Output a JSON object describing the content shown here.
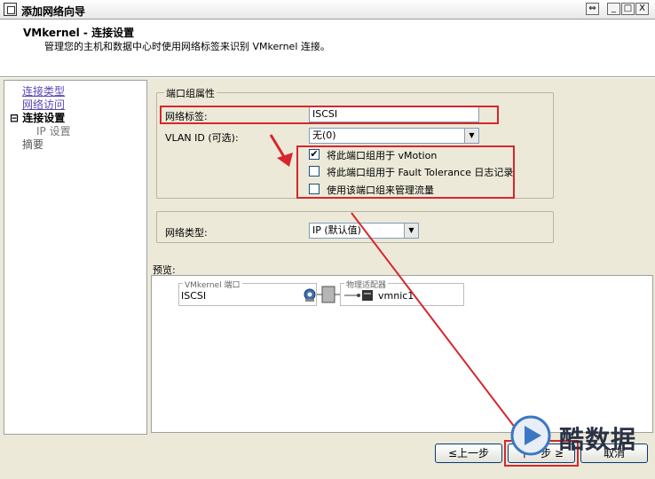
{
  "window": {
    "title": "添加网络向导",
    "controls": {
      "restore": "⇔",
      "minimize": "_",
      "maximize": "□",
      "close": "X"
    }
  },
  "header": {
    "title": "VMkernel - 连接设置",
    "description": "管理您的主机和数据中心时使用网络标签来识别 VMkernel 连接。"
  },
  "nav": {
    "items": [
      {
        "label": "连接类型",
        "state": "link"
      },
      {
        "label": "网络访问",
        "state": "link"
      },
      {
        "label": "连接设置",
        "state": "current",
        "prefix": "⊟"
      },
      {
        "label": "IP 设置",
        "state": "sub"
      },
      {
        "label": "摘要",
        "state": "inactive"
      }
    ]
  },
  "port_group": {
    "legend": "端口组属性",
    "network_label": {
      "label": "网络标签:",
      "value": "ISCSI"
    },
    "vlan": {
      "label": "VLAN ID (可选):",
      "value": "无(0)"
    },
    "options": [
      {
        "label": "将此端口组用于 vMotion",
        "checked": true,
        "mark": "✔"
      },
      {
        "label": "将此端口组用于 Fault Tolerance 日志记录",
        "checked": false,
        "mark": ""
      },
      {
        "label": "使用该端口组来管理流量",
        "checked": false,
        "mark": ""
      }
    ]
  },
  "network_type": {
    "label": "网络类型:",
    "value": "IP (默认值)"
  },
  "preview": {
    "label": "预览:",
    "vmkernel_legend": "VMkernel 端口",
    "port_name": "ISCSI",
    "adapter_legend": "物理适配器",
    "adapter_name": "vmnic1"
  },
  "buttons": {
    "back": "≤上一步",
    "next": "下一步 ≥",
    "cancel": "取消"
  },
  "watermark": {
    "text": "酷数据"
  },
  "colors": {
    "highlight": "#d7262d",
    "link": "#5a4ab7",
    "window_bg": "#ece9d8"
  }
}
